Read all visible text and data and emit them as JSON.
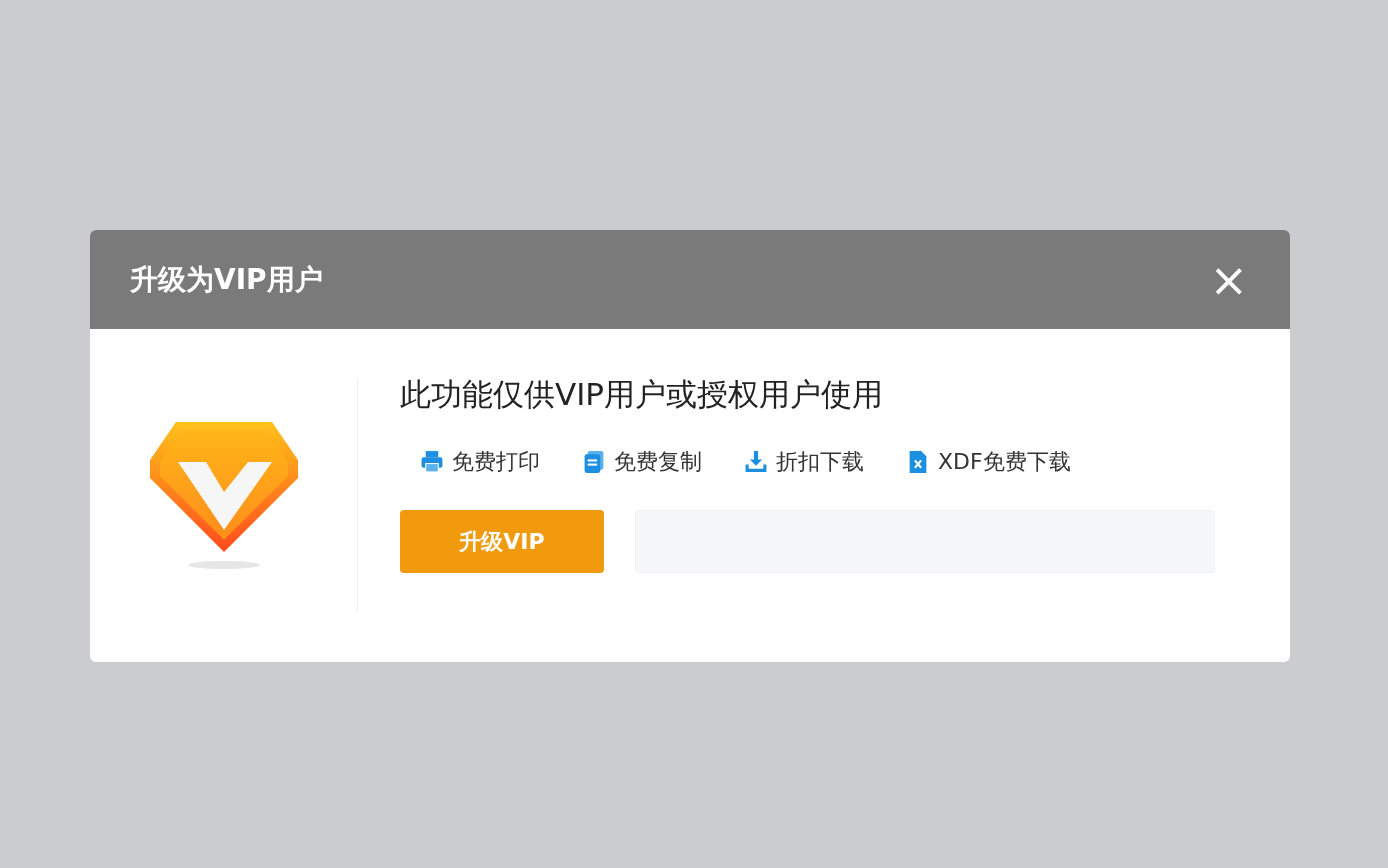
{
  "dialog": {
    "title": "升级为VIP用户",
    "close": "×"
  },
  "message": "此功能仅供VIP用户或授权用户使用",
  "features": [
    {
      "kind": "print",
      "label": "免费打印"
    },
    {
      "kind": "copy",
      "label": "免费复制"
    },
    {
      "kind": "download",
      "label": "折扣下载"
    },
    {
      "kind": "xdf",
      "label": "XDF免费下载"
    }
  ],
  "upgrade_button": "升级VIP"
}
